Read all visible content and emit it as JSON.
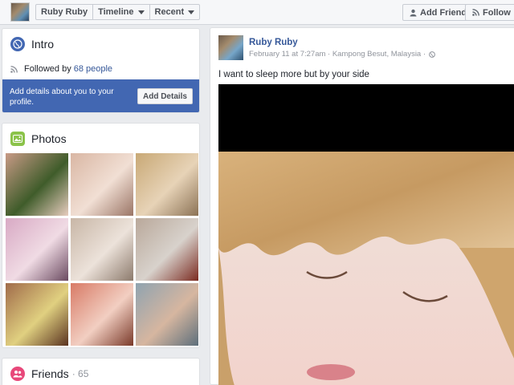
{
  "topbar": {
    "profile_name": "Ruby Ruby",
    "timeline_label": "Timeline",
    "recent_label": "Recent",
    "add_friend_label": "Add Friend",
    "follow_label": "Follow"
  },
  "intro": {
    "title": "Intro",
    "followed_prefix": "Followed by",
    "followed_link": "68 people",
    "banner_text": "Add details about you to your profile.",
    "add_details_label": "Add Details"
  },
  "photos": {
    "title": "Photos",
    "tiles": [
      {
        "name": "photo-1",
        "colors": [
          "#c89a86",
          "#3f5c2a",
          "#e8cdbf"
        ]
      },
      {
        "name": "photo-2",
        "colors": [
          "#d9b6a3",
          "#f1dfd4",
          "#9a7566"
        ]
      },
      {
        "name": "photo-3",
        "colors": [
          "#c8a875",
          "#e7d3b7",
          "#8b7255"
        ]
      },
      {
        "name": "photo-4",
        "colors": [
          "#d8a9c4",
          "#f0dbe4",
          "#6a4a60"
        ]
      },
      {
        "name": "photo-5",
        "colors": [
          "#c8b6a6",
          "#ece2da",
          "#8c7a6c"
        ]
      },
      {
        "name": "photo-6",
        "colors": [
          "#b9a89a",
          "#d8d2cc",
          "#7a2a20"
        ]
      },
      {
        "name": "photo-7",
        "colors": [
          "#a06b4a",
          "#e0d080",
          "#5a3320"
        ]
      },
      {
        "name": "photo-8",
        "colors": [
          "#d87a66",
          "#f2cfc2",
          "#7a3a2a"
        ]
      },
      {
        "name": "photo-9",
        "colors": [
          "#8fa3b0",
          "#d6b6a0",
          "#5d6f7b"
        ]
      }
    ]
  },
  "friends": {
    "title": "Friends",
    "count": "· 65"
  },
  "post": {
    "author": "Ruby Ruby",
    "meta": "February 11 at 7:27am · Kampong Besut, Malaysia ·",
    "text": "I want to sleep more but by your side"
  },
  "colors": {
    "link": "#365899",
    "banner": "#4267b2",
    "intro_icon": "#4267b2",
    "photos_icon": "#8bc34a",
    "friends_icon": "#e8487a"
  }
}
